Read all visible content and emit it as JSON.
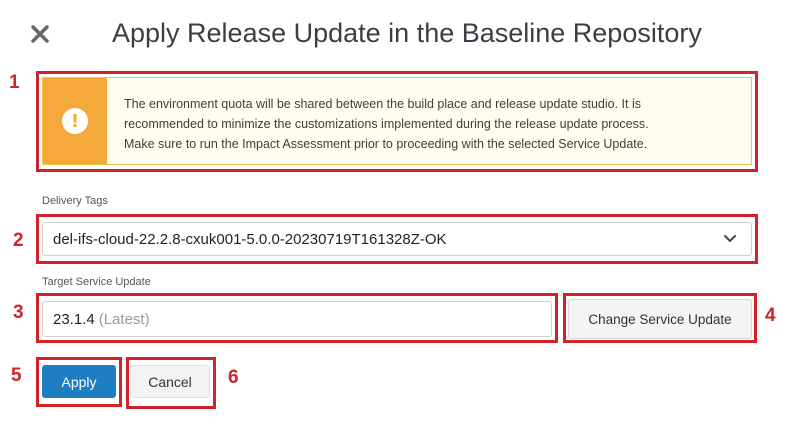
{
  "dialog": {
    "title": "Apply Release Update in the Baseline Repository"
  },
  "callouts": {
    "c1": "1",
    "c2": "2",
    "c3": "3",
    "c4": "4",
    "c5": "5",
    "c6": "6"
  },
  "warning": {
    "icon": "exclamation-circle-icon",
    "line1": "The environment quota will be shared between the build place and release update studio. It is",
    "line2": "recommended to minimize the customizations implemented during the release update process.",
    "line3": "Make sure to run the Impact Assessment prior to proceeding with the selected Service Update."
  },
  "delivery_tags": {
    "label": "Delivery Tags",
    "selected": "del-ifs-cloud-22.2.8-cxuk001-5.0.0-20230719T161328Z-OK"
  },
  "target_service_update": {
    "label": "Target Service Update",
    "value": "23.1.4",
    "hint": "(Latest)"
  },
  "buttons": {
    "change_service_update": "Change Service Update",
    "apply": "Apply",
    "cancel": "Cancel"
  },
  "colors": {
    "callout_red": "#d2232a",
    "primary_blue": "#1f7dc2",
    "warning_orange": "#f6a93b"
  }
}
